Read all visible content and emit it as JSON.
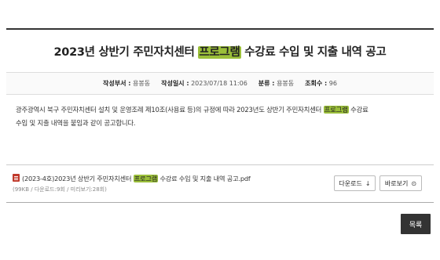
{
  "post": {
    "title_pre": "2023년 상반기 주민자치센터 ",
    "title_hl": "프로그램",
    "title_post": " 수강료 수입 및 지출 내역 공고",
    "meta": {
      "author_label": "작성부서 :",
      "author": "용봉동",
      "date_label": "작성일시 :",
      "date": "2023/07/18 11:06",
      "category_label": "분류 :",
      "category": "용봉동",
      "views_label": "조회수 :",
      "views": "96"
    },
    "body_pre": "광주광역시 북구 주민자치센터 설치 및 운영조례 제10조(사용료 등)의 규정에 따라 2023년도 상반기 주민자치센터 ",
    "body_hl": "프로그램",
    "body_post": " 수강료",
    "body_line2": "수입 및 지출 내역을 붙임과 같이 공고합니다."
  },
  "attachment": {
    "icon": "pdf-file-icon",
    "name_pre": "(2023-4호)2023년 상반기 주민자치센터 ",
    "name_hl": "프로그램",
    "name_post": " 수강료 수입 및 지출 내역 공고.pdf",
    "info": "(99KB / 다운로드:9회 / 미리보기:28회)",
    "download_label": "다운로드",
    "download_icon": "↓",
    "preview_label": "바로보기",
    "preview_icon": "⊙"
  },
  "actions": {
    "list_label": "목록"
  },
  "colors": {
    "highlight": "#9bbf3a",
    "list_button_bg": "#333333"
  }
}
